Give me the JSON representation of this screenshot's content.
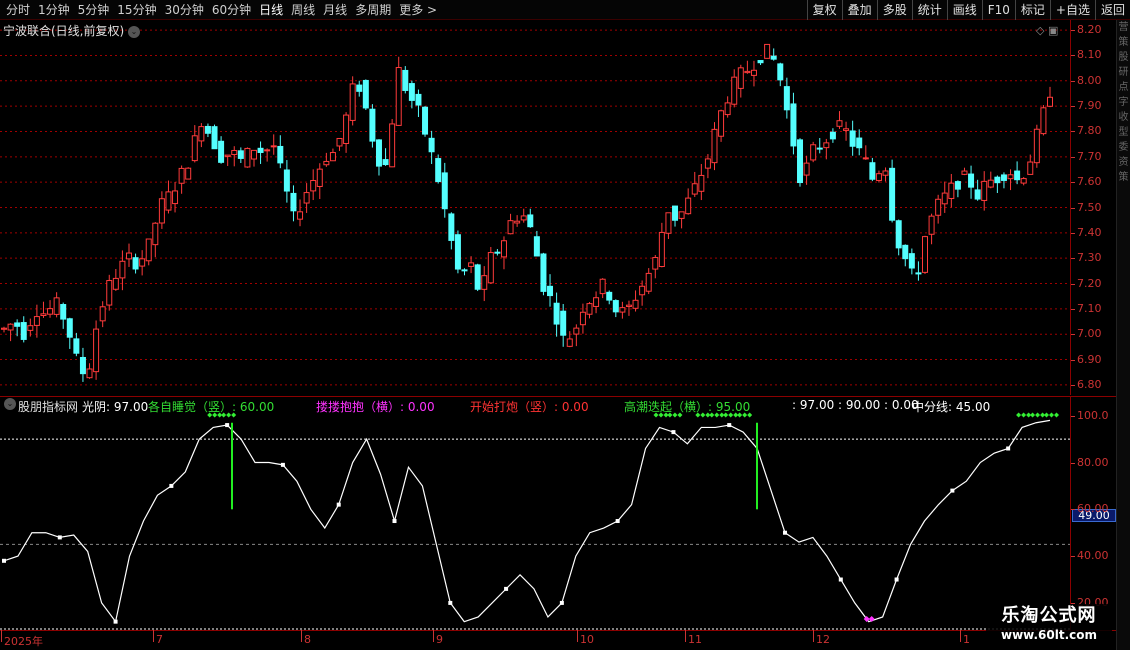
{
  "toolbar": {
    "period_tabs": [
      "分时",
      "1分钟",
      "5分钟",
      "15分钟",
      "30分钟",
      "60分钟",
      "日线",
      "周线",
      "月线",
      "多周期",
      "更多 >"
    ],
    "active_tab": "日线",
    "tool_buttons": [
      "复权",
      "叠加",
      "多股",
      "统计",
      "画线",
      "F10",
      "标记",
      "+自选",
      "返回"
    ]
  },
  "main_chart": {
    "stock_title": "宁波联合(日线,前复权)",
    "price_ticks": [
      "8.20",
      "8.10",
      "8.00",
      "7.90",
      "7.80",
      "7.70",
      "7.60",
      "7.50",
      "7.40",
      "7.30",
      "7.20",
      "7.10",
      "7.00",
      "6.90",
      "6.80"
    ],
    "colors": {
      "up": "#ff3b3b",
      "down": "#54ffff",
      "grid": "#a00000"
    }
  },
  "indicator": {
    "name": "股朋指标网",
    "items": [
      {
        "text": "光阴: 97.00",
        "color": "#ffffff"
      },
      {
        "text": "各自睡觉（竖）: 60.00",
        "color": "#33dd33"
      },
      {
        "text": "搂搂抱抱（横）: 0.00",
        "color": "#ff33ff"
      },
      {
        "text": "开始打炮（竖）: 0.00",
        "color": "#ff3333"
      },
      {
        "text": "高潮迭起（横）: 95.00",
        "color": "#33dd33"
      },
      {
        "text": ": 97.00 : 90.00 : 0.00",
        "color": "#ffffff"
      },
      {
        "text": "中分线: 45.00",
        "color": "#ffffff"
      }
    ],
    "ticks": [
      "100.0",
      "80.00",
      "60.00",
      "40.00",
      "20.00"
    ],
    "current_value": "49.00"
  },
  "date_axis": [
    "2025年",
    "7",
    "8",
    "9",
    "10",
    "11",
    "12",
    "1"
  ],
  "side_strip": [
    "营",
    "策",
    "股",
    "研",
    "点",
    "字",
    "收",
    "型",
    "委",
    "资",
    "策"
  ],
  "watermark": {
    "title": "乐淘公式网",
    "url": "www.60lt.com"
  },
  "chart_data": {
    "type": "candlestick",
    "price_axis_range": [
      6.76,
      8.24
    ],
    "indicator_axis_range": [
      8,
      108
    ],
    "price_path": [
      7.02,
      7.05,
      7.0,
      7.1,
      7.08,
      7.12,
      7.05,
      6.9,
      6.82,
      7.05,
      7.18,
      7.25,
      7.3,
      7.28,
      7.35,
      7.5,
      7.55,
      7.62,
      7.7,
      7.85,
      7.78,
      7.7,
      7.72,
      7.68,
      7.74,
      7.72,
      7.75,
      7.6,
      7.45,
      7.55,
      7.62,
      7.7,
      7.72,
      7.85,
      8.02,
      7.88,
      7.7,
      7.66,
      8.05,
      7.95,
      7.88,
      7.75,
      7.6,
      7.4,
      7.22,
      7.28,
      7.15,
      7.3,
      7.35,
      7.45,
      7.48,
      7.4,
      7.2,
      7.12,
      6.98,
      7.0,
      7.12,
      7.15,
      7.2,
      7.1,
      7.08,
      7.15,
      7.22,
      7.3,
      7.5,
      7.45,
      7.52,
      7.6,
      7.7,
      7.85,
      7.95,
      8.02,
      8.05,
      8.1,
      8.12,
      8.0,
      7.8,
      7.6,
      7.72,
      7.75,
      7.8,
      7.82,
      7.75,
      7.7,
      7.6,
      7.7,
      7.4,
      7.3,
      7.2,
      7.4,
      7.5,
      7.55,
      7.6,
      7.62,
      7.55,
      7.6,
      7.62,
      7.65,
      7.6,
      7.68,
      7.82,
      7.96
    ],
    "indicator_series": {
      "name": "光阴",
      "values": [
        38,
        40,
        50,
        50,
        48,
        49,
        42,
        20,
        12,
        40,
        55,
        66,
        70,
        76,
        90,
        95,
        96,
        90,
        80,
        80,
        79,
        72,
        60,
        52,
        62,
        80,
        90,
        75,
        55,
        78,
        70,
        45,
        20,
        12,
        14,
        20,
        26,
        32,
        26,
        14,
        20,
        40,
        50,
        52,
        55,
        62,
        86,
        95,
        93,
        88,
        95,
        95,
        96,
        93,
        86,
        68,
        50,
        46,
        48,
        40,
        30,
        20,
        12,
        14,
        30,
        45,
        55,
        62,
        68,
        72,
        80,
        84,
        86,
        95,
        97,
        98
      ],
      "reference_lines": [
        90,
        45,
        0
      ],
      "color": "#ffffff"
    }
  }
}
